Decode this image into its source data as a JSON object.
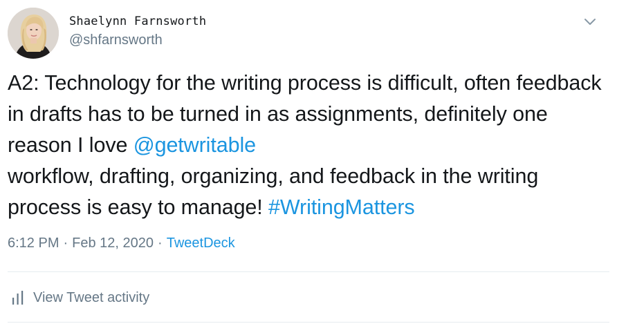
{
  "user": {
    "display_name": "Shaelynn Farnsworth",
    "handle": "@shfarnsworth"
  },
  "tweet": {
    "text_parts": {
      "p1": "A2: Technology for the writing process is difficult, often feedback in drafts has to be turned in as assignments, definitely one reason I love ",
      "mention": "@getwritable",
      "p2": " workflow, drafting, organizing, and feedback in the writing process is easy to manage! ",
      "hashtag": "#WritingMatters"
    },
    "time": "6:12 PM",
    "date": "Feb 12, 2020",
    "separator": "·",
    "source": "TweetDeck"
  },
  "actions": {
    "view_activity_label": "View Tweet activity"
  },
  "icons": {
    "menu": "chevron-down-icon",
    "activity": "bar-chart-icon"
  },
  "colors": {
    "link": "#1b95e0",
    "secondary_text": "#657786",
    "primary_text": "#14171a",
    "divider": "#e6ecf0"
  }
}
